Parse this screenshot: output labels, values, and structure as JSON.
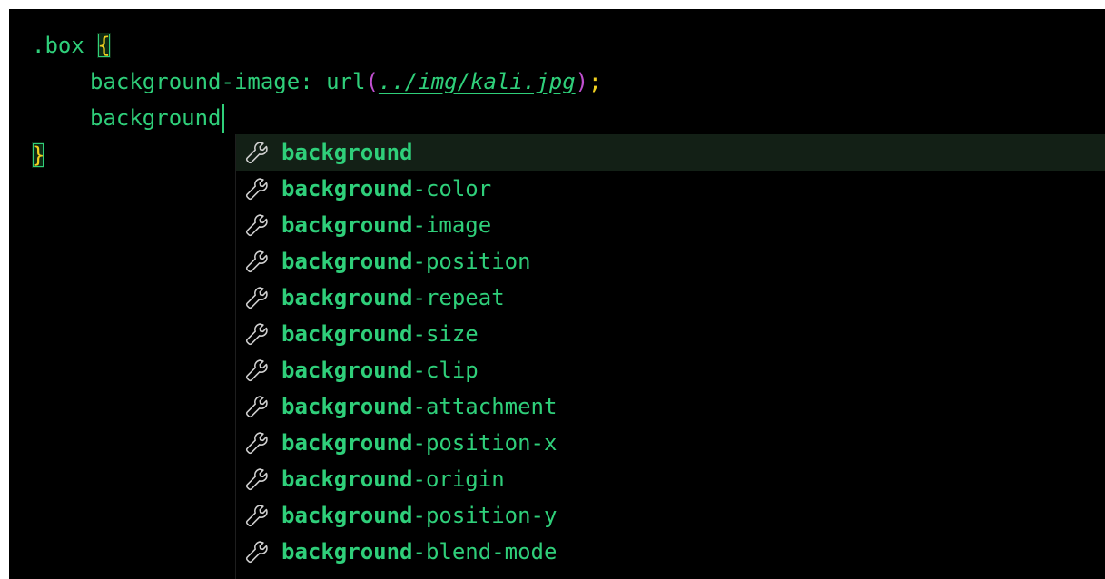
{
  "code": {
    "line1": {
      "selector": ".box ",
      "open_brace": "{"
    },
    "line2": {
      "property": "background-image",
      "colon": ": ",
      "fn": "url",
      "open_paren": "(",
      "url": "../img/kali.jpg",
      "close_paren": ")",
      "semi": ";"
    },
    "line3": {
      "typed": "background"
    },
    "line4": {
      "close_brace": "}"
    }
  },
  "suggestions": [
    {
      "match": "background",
      "rest": "",
      "icon": "wrench-icon",
      "selected": true
    },
    {
      "match": "background",
      "rest": "-color",
      "icon": "wrench-icon"
    },
    {
      "match": "background",
      "rest": "-image",
      "icon": "wrench-icon"
    },
    {
      "match": "background",
      "rest": "-position",
      "icon": "wrench-icon"
    },
    {
      "match": "background",
      "rest": "-repeat",
      "icon": "wrench-icon"
    },
    {
      "match": "background",
      "rest": "-size",
      "icon": "wrench-icon"
    },
    {
      "match": "background",
      "rest": "-clip",
      "icon": "wrench-icon"
    },
    {
      "match": "background",
      "rest": "-attachment",
      "icon": "wrench-icon"
    },
    {
      "match": "background",
      "rest": "-position-x",
      "icon": "wrench-icon"
    },
    {
      "match": "background",
      "rest": "-origin",
      "icon": "wrench-icon"
    },
    {
      "match": "background",
      "rest": "-position-y",
      "icon": "wrench-icon"
    },
    {
      "match": "background",
      "rest": "-blend-mode",
      "icon": "wrench-icon"
    }
  ],
  "colors": {
    "text": "#2fcf7a",
    "brace": "#f0d020",
    "paren": "#c04fd0",
    "background": "#000000",
    "selected_row": "#132016"
  }
}
